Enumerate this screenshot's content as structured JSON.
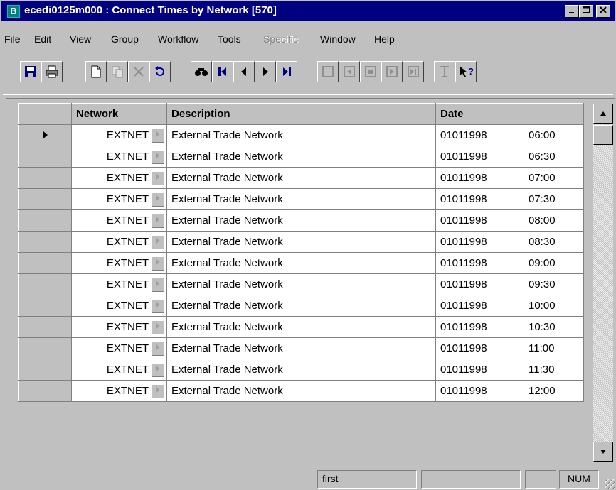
{
  "window": {
    "app_icon": "B",
    "title": "ecedi0125m000 : Connect Times by Network [570]",
    "controls": [
      "minimize-icon",
      "maximize-icon",
      "close-icon"
    ]
  },
  "menu": {
    "items": [
      {
        "label": "File"
      },
      {
        "label": "Edit"
      },
      {
        "label": "View"
      },
      {
        "label": "Group"
      },
      {
        "label": "Workflow"
      },
      {
        "label": "Tools"
      },
      {
        "label": "Specific",
        "disabled": true
      },
      {
        "label": "Window"
      },
      {
        "label": "Help"
      }
    ]
  },
  "toolbar": {
    "icons": [
      "save-icon",
      "print-icon",
      "new-icon",
      "copy-icon",
      "delete-icon",
      "undo-icon",
      "find-icon",
      "first-record-icon",
      "previous-record-icon",
      "next-record-icon",
      "last-record-icon",
      "first-group-icon",
      "previous-group-icon",
      "group-icon",
      "next-group-icon",
      "last-group-icon",
      "text-icon",
      "context-help-icon"
    ]
  },
  "grid": {
    "headers": {
      "network": "Network",
      "description": "Description",
      "date": "Date"
    },
    "rows": [
      {
        "network": "EXTNET",
        "description": "External Trade Network",
        "date": "01011998",
        "time": "06:00",
        "current": true
      },
      {
        "network": "EXTNET",
        "description": "External Trade Network",
        "date": "01011998",
        "time": "06:30"
      },
      {
        "network": "EXTNET",
        "description": "External Trade Network",
        "date": "01011998",
        "time": "07:00"
      },
      {
        "network": "EXTNET",
        "description": "External Trade Network",
        "date": "01011998",
        "time": "07:30"
      },
      {
        "network": "EXTNET",
        "description": "External Trade Network",
        "date": "01011998",
        "time": "08:00"
      },
      {
        "network": "EXTNET",
        "description": "External Trade Network",
        "date": "01011998",
        "time": "08:30"
      },
      {
        "network": "EXTNET",
        "description": "External Trade Network",
        "date": "01011998",
        "time": "09:00"
      },
      {
        "network": "EXTNET",
        "description": "External Trade Network",
        "date": "01011998",
        "time": "09:30"
      },
      {
        "network": "EXTNET",
        "description": "External Trade Network",
        "date": "01011998",
        "time": "10:00"
      },
      {
        "network": "EXTNET",
        "description": "External Trade Network",
        "date": "01011998",
        "time": "10:30"
      },
      {
        "network": "EXTNET",
        "description": "External Trade Network",
        "date": "01011998",
        "time": "11:00"
      },
      {
        "network": "EXTNET",
        "description": "External Trade Network",
        "date": "01011998",
        "time": "11:30"
      },
      {
        "network": "EXTNET",
        "description": "External Trade Network",
        "date": "01011998",
        "time": "12:00"
      }
    ]
  },
  "status": {
    "message": "first",
    "num": "NUM"
  }
}
